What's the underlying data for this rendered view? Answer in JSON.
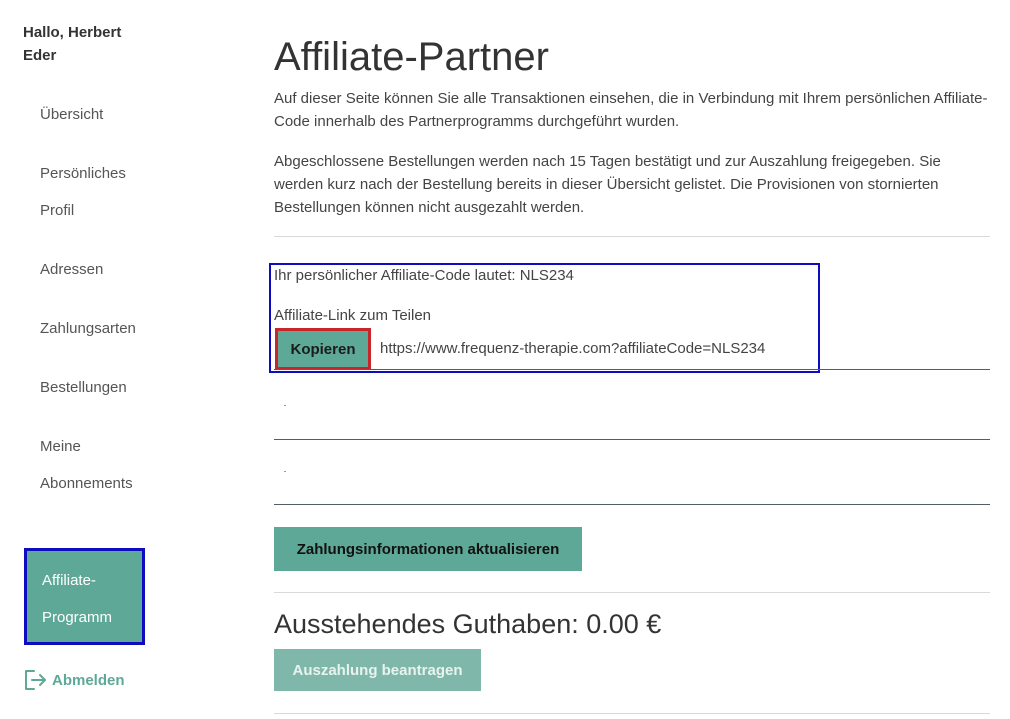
{
  "sidebar": {
    "greeting": "Hallo, Herbert Eder",
    "items": [
      {
        "label": "Übersicht"
      },
      {
        "label": "Persönliches Profil"
      },
      {
        "label": "Adressen"
      },
      {
        "label": "Zahlungsarten"
      },
      {
        "label": "Bestellungen"
      },
      {
        "label": "Meine Abonnements"
      },
      {
        "label": "Affiliate-Programm"
      }
    ],
    "logout_label": "Abmelden",
    "logout_icon": "logout-icon"
  },
  "main": {
    "title": "Affiliate-Partner",
    "intro": "Auf dieser Seite können Sie alle Transaktionen einsehen, die in Verbindung mit Ihrem persönlichen Affiliate-Code innerhalb des Partnerprogramms durchgeführt wurden.",
    "info": "Abgeschlossene Bestellungen werden nach 15 Tagen bestätigt und zur Auszahlung freigegeben. Sie werden kurz nach der Bestellung bereits in dieser Übersicht gelistet. Die Provisionen von stornierten Bestellungen können nicht ausgezahlt werden.",
    "code_text": "Ihr persönlicher Affiliate-Code lautet: NLS234",
    "link_label": "Affiliate-Link zum Teilen",
    "copy_label": "Kopieren",
    "link_url": "https://www.frequenz-therapie.com?affiliateCode=NLS234",
    "update_button": "Zahlungsinformationen aktualisieren",
    "balance": "Ausstehendes Guthaben: 0.00 €",
    "payout_button": "Auszahlung beantragen"
  },
  "colors": {
    "accent": "#5ea898",
    "highlight_border": "#0d0dbf",
    "copy_border": "#c7262b"
  }
}
